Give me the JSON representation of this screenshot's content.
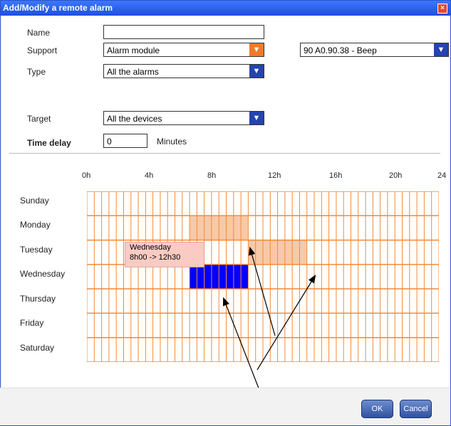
{
  "window": {
    "title": "Add/Modify a remote alarm"
  },
  "form": {
    "name_label": "Name",
    "name_value": "",
    "support_label": "Support",
    "support_value": "Alarm module",
    "support_device_value": "90 A0.90.38 - Beep",
    "type_label": "Type",
    "type_value": "All the alarms",
    "target_label": "Target",
    "target_value": "All the devices",
    "time_delay_label": "Time delay",
    "time_delay_value": "0",
    "minutes_label": "Minutes"
  },
  "schedule": {
    "hour_ticks": [
      "0h",
      "4h",
      "8h",
      "12h",
      "16h",
      "20h",
      "24"
    ],
    "days": [
      "Sunday",
      "Monday",
      "Tuesday",
      "Wednesday",
      "Thursday",
      "Friday",
      "Saturday"
    ],
    "highlights": [
      {
        "day": "Monday",
        "from_hour": 7,
        "to_hour": 11,
        "color": "#f8c9a7"
      },
      {
        "day": "Tuesday",
        "from_hour": 11,
        "to_hour": 15,
        "color": "#f8c9a7"
      },
      {
        "day": "Wednesday",
        "from_hour": 7,
        "to_hour": 11,
        "color": "#0000ff"
      }
    ],
    "tooltip_title": "Wednesday",
    "tooltip_range": "8h00 -> 12h30",
    "grid_color": "#f08a3a"
  },
  "buttons": {
    "ok": "OK",
    "cancel": "Cancel"
  }
}
